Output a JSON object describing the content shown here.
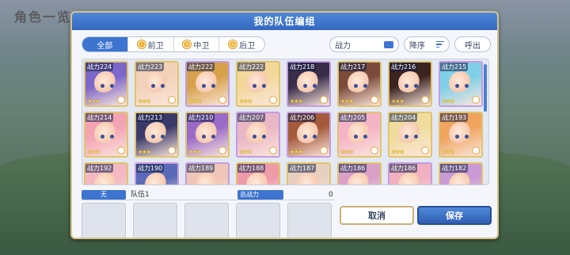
{
  "background": {
    "title": "角色一览"
  },
  "dialog": {
    "title": "我的队伍编组"
  },
  "filters": {
    "tabs": [
      {
        "label": "全部",
        "active": true
      },
      {
        "label": "前卫",
        "active": false
      },
      {
        "label": "中卫",
        "active": false
      },
      {
        "label": "后卫",
        "active": false
      }
    ],
    "power_label": "战力",
    "sort_label": "降序",
    "call_label": "呼出"
  },
  "characters": [
    {
      "power": "战力224",
      "stars": "★★★",
      "color": "#7c66c9"
    },
    {
      "power": "战力223",
      "stars": "★★★",
      "color": "#f2d2b8"
    },
    {
      "power": "战力222",
      "stars": "★★★",
      "color": "#d6a14a"
    },
    {
      "power": "战力222",
      "stars": "★★★",
      "color": "#f3d89a"
    },
    {
      "power": "战力218",
      "stars": "★★★",
      "color": "#3a2d4a"
    },
    {
      "power": "战力217",
      "stars": "★★★",
      "color": "#7b4a3a"
    },
    {
      "power": "战力216",
      "stars": "★★★",
      "color": "#3b2320"
    },
    {
      "power": "战力215",
      "stars": "★★★",
      "color": "#7fd0e8"
    },
    {
      "power": "战力214",
      "stars": "★★★",
      "color": "#f3a3b4"
    },
    {
      "power": "战力213",
      "stars": "★★★",
      "color": "#3a3a6a"
    },
    {
      "power": "战力210",
      "stars": "★★★",
      "color": "#9a6ac9"
    },
    {
      "power": "战力207",
      "stars": "★★★",
      "color": "#e9b6c6"
    },
    {
      "power": "战力206",
      "stars": "★★★",
      "color": "#a55a3c"
    },
    {
      "power": "战力205",
      "stars": "★★★",
      "color": "#f5b3c8"
    },
    {
      "power": "战力204",
      "stars": "★★★",
      "color": "#f0dd9e"
    },
    {
      "power": "战力193",
      "stars": "★★★",
      "color": "#f0a45e"
    },
    {
      "power": "战力192",
      "stars": "",
      "color": "#f3b8c3"
    },
    {
      "power": "战力190",
      "stars": "",
      "color": "#5a6ab9"
    },
    {
      "power": "战力189",
      "stars": "",
      "color": "#efc5b8"
    },
    {
      "power": "战力188",
      "stars": "",
      "color": "#ef9aa8"
    },
    {
      "power": "战力187",
      "stars": "",
      "color": "#e8d0c0"
    },
    {
      "power": "战力186",
      "stars": "",
      "color": "#d9a0c8"
    },
    {
      "power": "战力186",
      "stars": "",
      "color": "#f1b0c0"
    },
    {
      "power": "战力182",
      "stars": "",
      "color": "#c99ad6"
    }
  ],
  "team": {
    "tag": "无",
    "name": "队伍1",
    "total_label": "总战力",
    "total_value": "0",
    "slots": 5
  },
  "actions": {
    "cancel": "取消",
    "save": "保存"
  }
}
